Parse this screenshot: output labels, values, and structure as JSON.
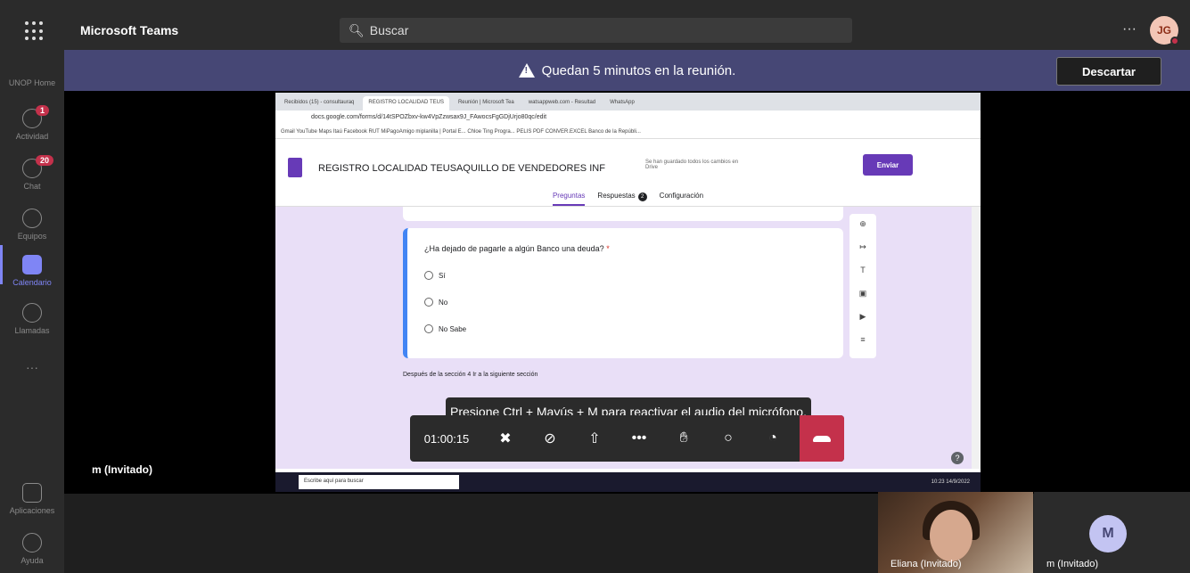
{
  "app": {
    "brand": "Microsoft Teams",
    "search_placeholder": "Buscar",
    "more": "···",
    "avatar_initials": "JG"
  },
  "rail": {
    "items": [
      {
        "label": "UNOP Home"
      },
      {
        "label": "Actividad",
        "badge": "1"
      },
      {
        "label": "Chat",
        "badge": "20"
      },
      {
        "label": "Equipos"
      },
      {
        "label": "Calendario",
        "active": true
      },
      {
        "label": "Llamadas"
      },
      {
        "label": "···"
      },
      {
        "label": "Aplicaciones"
      },
      {
        "label": "Ayuda"
      }
    ]
  },
  "banner": {
    "message": "Quedan 5 minutos en la reunión.",
    "dismiss": "Descartar"
  },
  "share": {
    "tabs": [
      "Recibidos (15) - consultauraq",
      "REGISTRO LOCALIDAD TEUS",
      "Reunión | Microsoft Tea",
      "watsappweb.com - Resultad",
      "WhatsApp"
    ],
    "url": "docs.google.com/forms/d/14tSPOZbxv-kw4VpZzwsax9J_FAwocsFgGDjUrjo80qc/edit",
    "bookmarks": "Gmail  YouTube  Maps  Itaú  Facebook  RUT  MiPagoAmigo  miplanilla | Portal E...  Chloe Ting Progra...  PELIS  PDF  CONVER.EXCEL  Banco de la Repúbli...",
    "form_title": "REGISTRO LOCALIDAD TEUSAQUILLO DE VENDEDORES INF",
    "saved": "Se han guardado todos los cambios en Drive",
    "send": "Enviar",
    "tab_questions": "Preguntas",
    "tab_responses": "Respuestas",
    "responses_count": "2",
    "tab_settings": "Configuración",
    "question": "¿Ha dejado de pagarle a algún Banco una deuda?",
    "required": "*",
    "options": [
      "Sí",
      "No",
      "No Sabe"
    ],
    "after_section": "Después de la sección 4   Ir a la siguiente sección",
    "taskbar_search": "Escribe aquí para buscar",
    "taskbar_clock": "10:23  14/9/2022"
  },
  "call": {
    "mic_tip": "Presione Ctrl + Mayús + M para reactivar el audio del micrófono.",
    "elapsed": "01:00:15"
  },
  "participants": {
    "main": "m (Invitado)",
    "tile1": "Eliana (Invitado)",
    "tile2": "m (Invitado)",
    "tile2_initial": "M"
  }
}
